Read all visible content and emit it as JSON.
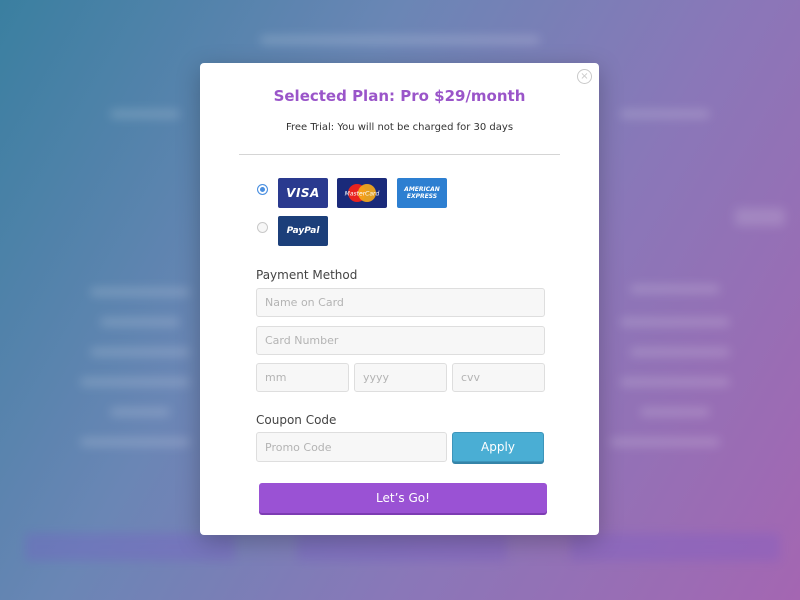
{
  "modal": {
    "close_glyph": "×",
    "plan_title": "Selected Plan: Pro $29/month",
    "trial_note": "Free Trial: You will not be charged for 30 days"
  },
  "payment_options": {
    "cards_selected": true,
    "paypal_selected": false,
    "visa_label": "VISA",
    "mastercard_label": "MasterCard",
    "amex_label_line1": "AMERICAN",
    "amex_label_line2": "EXPRESS",
    "paypal_label": "PayPal"
  },
  "payment_method": {
    "label": "Payment Method",
    "name_placeholder": "Name on Card",
    "card_number_placeholder": "Card Number",
    "month_placeholder": "mm",
    "year_placeholder": "yyyy",
    "cvv_placeholder": "cvv"
  },
  "coupon": {
    "label": "Coupon Code",
    "promo_placeholder": "Promo Code",
    "apply_label": "Apply"
  },
  "submit": {
    "label": "Let’s Go!"
  },
  "colors": {
    "accent_purple": "#9a52d4",
    "apply_blue": "#4aaed4",
    "radio_blue": "#4a8fe0"
  }
}
